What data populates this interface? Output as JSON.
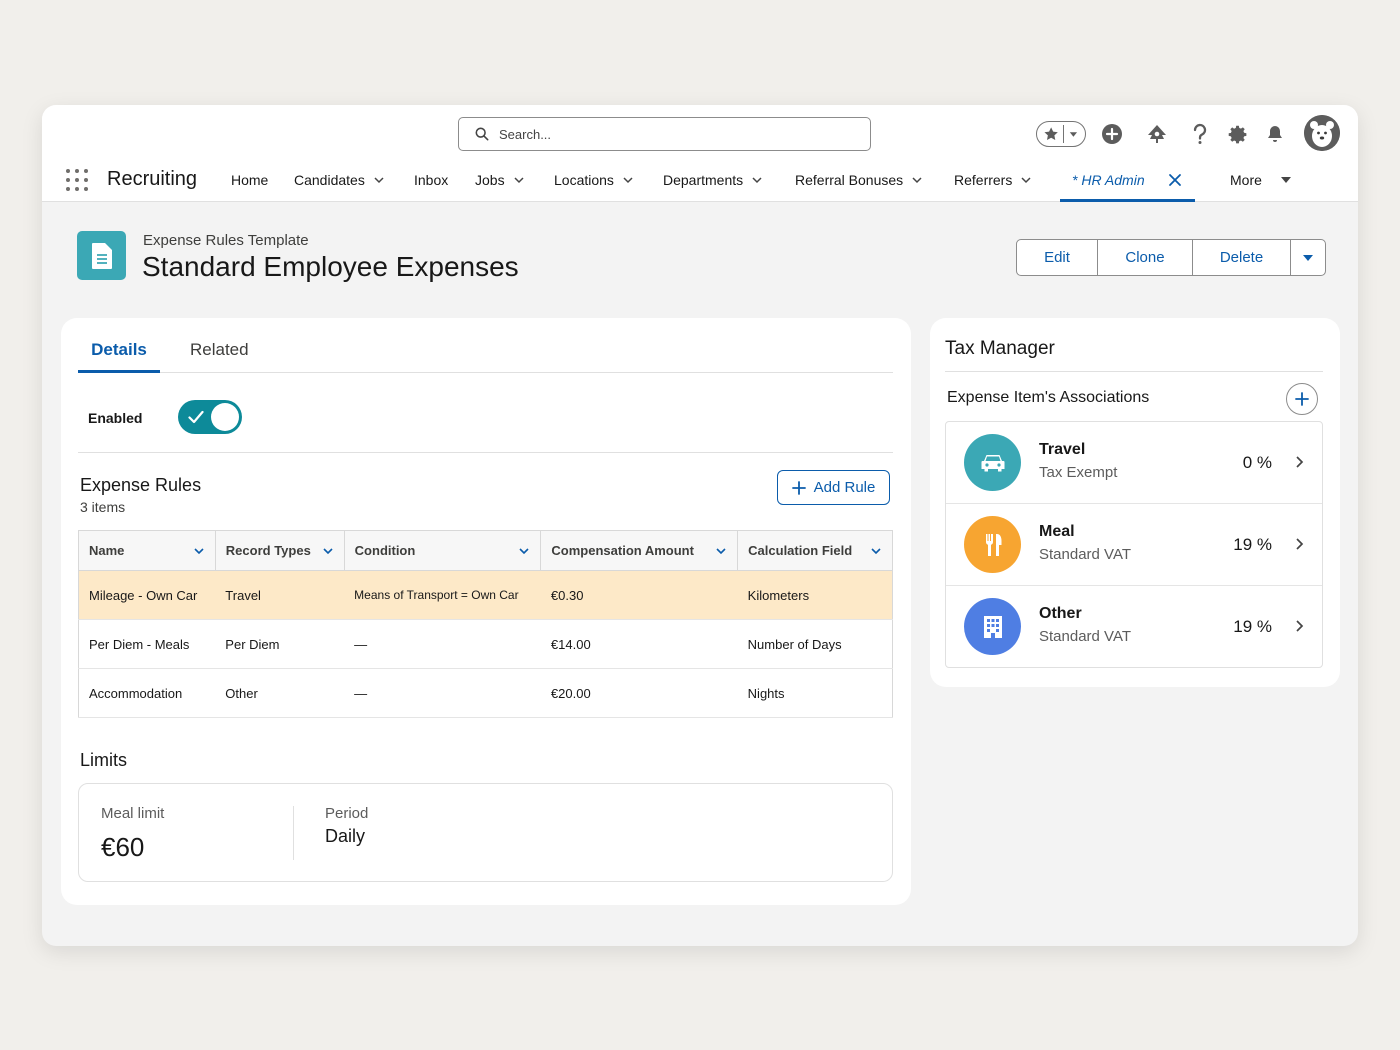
{
  "header": {
    "search_placeholder": "Search...",
    "icons": [
      "search-icon",
      "star-icon",
      "chevron-down-icon",
      "add-icon",
      "setup-assistant-icon",
      "help-icon",
      "gear-icon",
      "bell-icon",
      "avatar"
    ]
  },
  "nav": {
    "app_name": "Recruiting",
    "items": [
      {
        "label": "Home",
        "has_menu": false
      },
      {
        "label": "Candidates",
        "has_menu": true
      },
      {
        "label": "Inbox",
        "has_menu": false
      },
      {
        "label": "Jobs",
        "has_menu": true
      },
      {
        "label": "Locations",
        "has_menu": true
      },
      {
        "label": "Departments",
        "has_menu": true
      },
      {
        "label": "Referral Bonuses",
        "has_menu": true
      },
      {
        "label": "Referrers",
        "has_menu": true
      }
    ],
    "active_tab": "* HR Admin",
    "more_label": "More"
  },
  "record": {
    "object_label": "Expense Rules Template",
    "title": "Standard Employee Expenses",
    "actions": [
      "Edit",
      "Clone",
      "Delete"
    ]
  },
  "details": {
    "tabs": [
      "Details",
      "Related"
    ],
    "active_tab": "Details",
    "enabled_label": "Enabled",
    "enabled": true,
    "rules": {
      "title": "Expense Rules",
      "count": "3 items",
      "add_label": "Add Rule",
      "columns": [
        "Name",
        "Record Types",
        "Condition",
        "Compensation Amount",
        "Calculation Field"
      ],
      "rows": [
        [
          "Mileage - Own Car",
          "Travel",
          "Means of Transport = Own Car",
          "€0.30",
          "Kilometers"
        ],
        [
          "Per Diem - Meals",
          "Per Diem",
          "—",
          "€14.00",
          "Number of Days"
        ],
        [
          "Accommodation",
          "Other",
          "—",
          "€20.00",
          "Nights"
        ]
      ],
      "highlighted_row": 0
    },
    "limits": {
      "title": "Limits",
      "meal_limit_label": "Meal limit",
      "meal_limit_value": "€60",
      "period_label": "Period",
      "period_value": "Daily"
    }
  },
  "tax_manager": {
    "title": "Tax Manager",
    "assoc_title": "Expense Item's Associations",
    "items": [
      {
        "name": "Travel",
        "sub": "Tax Exempt",
        "pct": "0 %",
        "color": "#3ba8b5",
        "icon": "car-icon"
      },
      {
        "name": "Meal",
        "sub": "Standard VAT",
        "pct": "19 %",
        "color": "#f7a531",
        "icon": "fork-knife-icon"
      },
      {
        "name": "Other",
        "sub": "Standard VAT",
        "pct": "19 %",
        "color": "#4f7ee3",
        "icon": "building-icon"
      }
    ]
  },
  "colors": {
    "brand_blue": "#0b5cab",
    "toggle_teal": "#0d8a99",
    "highlight_row": "#fde9c8"
  }
}
